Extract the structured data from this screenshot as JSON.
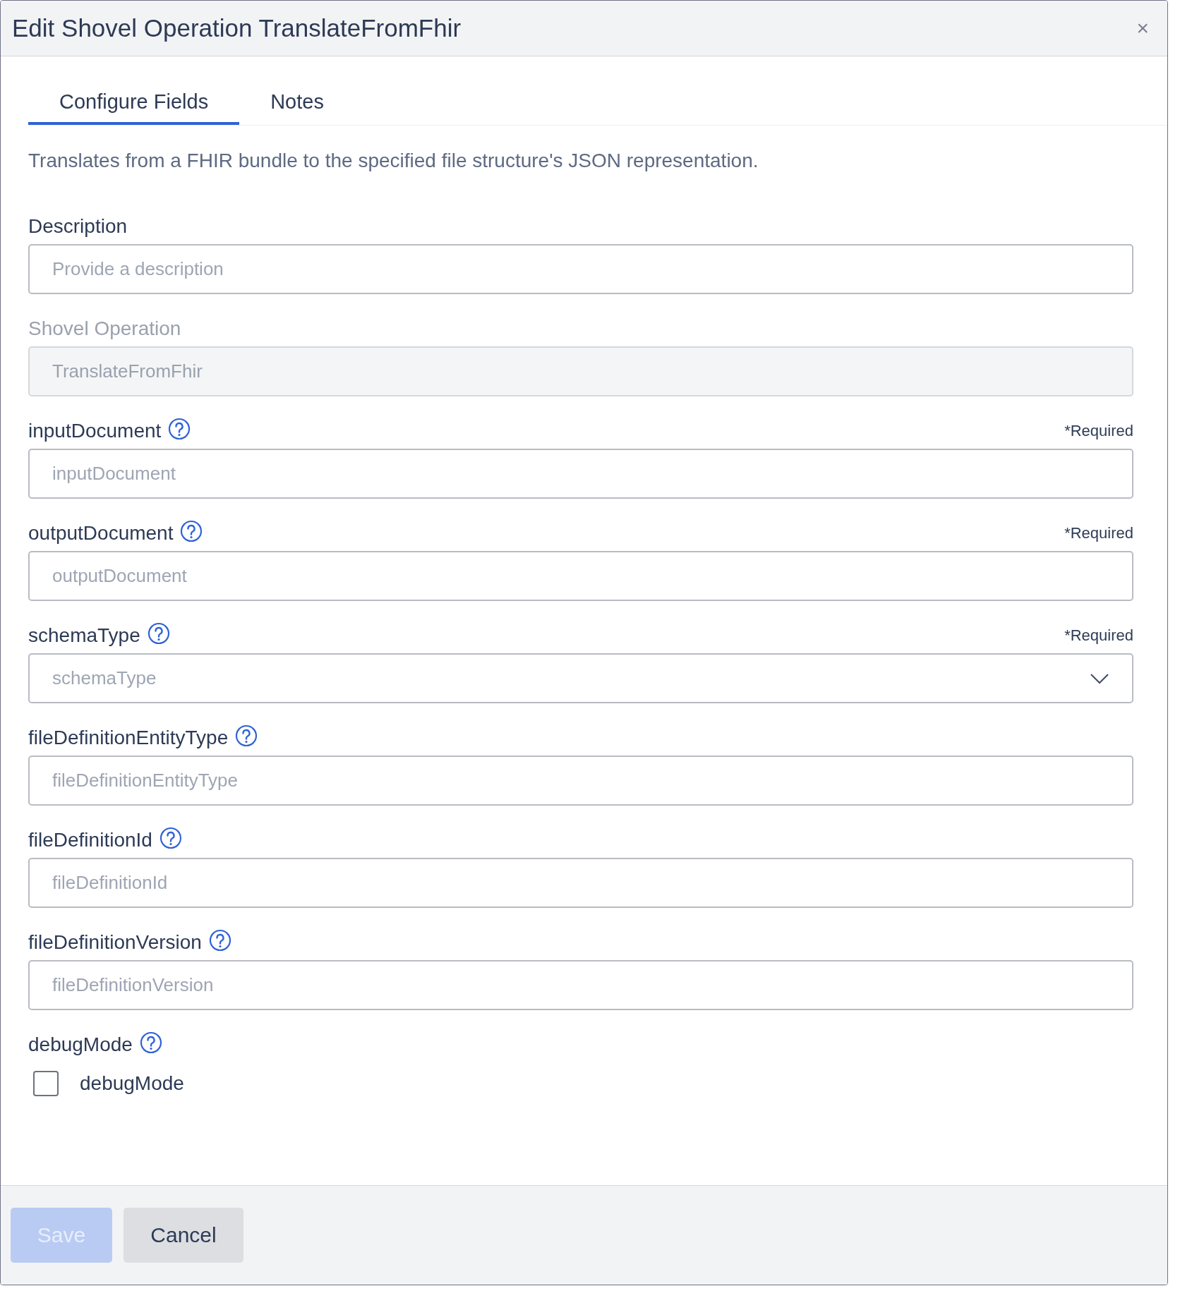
{
  "dialog": {
    "title": "Edit Shovel Operation TranslateFromFhir",
    "close": "×"
  },
  "tabs": [
    {
      "label": "Configure Fields",
      "selected": true
    },
    {
      "label": "Notes",
      "selected": false
    }
  ],
  "intro": "Translates from a FHIR bundle to the specified file structure's JSON representation.",
  "fields": [
    {
      "kind": "text",
      "label": "Description",
      "help": false,
      "placeholder": "Provide a description"
    },
    {
      "kind": "text",
      "label": "Shovel Operation",
      "help": false,
      "disabled": true,
      "value": "TranslateFromFhir"
    },
    {
      "kind": "text",
      "label": "inputDocument",
      "help": true,
      "required_note": "*Required",
      "placeholder": "inputDocument"
    },
    {
      "kind": "text",
      "label": "outputDocument",
      "help": true,
      "required_note": "*Required",
      "placeholder": "outputDocument"
    },
    {
      "kind": "select",
      "label": "schemaType",
      "help": true,
      "required_note": "*Required",
      "placeholder": "schemaType"
    },
    {
      "kind": "text",
      "label": "fileDefinitionEntityType",
      "help": true,
      "placeholder": "fileDefinitionEntityType"
    },
    {
      "kind": "text",
      "label": "fileDefinitionId",
      "help": true,
      "placeholder": "fileDefinitionId"
    },
    {
      "kind": "text",
      "label": "fileDefinitionVersion",
      "help": true,
      "placeholder": "fileDefinitionVersion"
    },
    {
      "kind": "checkbox",
      "label": "debugMode",
      "help": true,
      "option": "debugMode",
      "checked": false
    }
  ],
  "buttons": [
    {
      "label": "Save",
      "disabled": true
    },
    {
      "label": "Cancel",
      "disabled": false
    }
  ]
}
